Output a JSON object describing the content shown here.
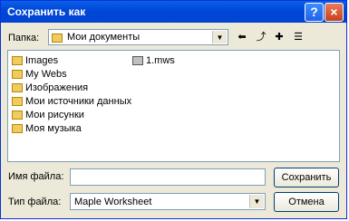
{
  "window": {
    "title": "Сохранить как"
  },
  "toolbar": {
    "folder_label": "Папка:",
    "folder_value": "Мои документы"
  },
  "files": [
    {
      "name": "Images",
      "icon": "folder-icon"
    },
    {
      "name": "My Webs",
      "icon": "folder-icon"
    },
    {
      "name": "Изображения",
      "icon": "folder-icon"
    },
    {
      "name": "Мои источники данных",
      "icon": "folder-data-icon"
    },
    {
      "name": "Мои рисунки",
      "icon": "folder-pictures-icon"
    },
    {
      "name": "Моя музыка",
      "icon": "folder-music-icon"
    },
    {
      "name": "1.mws",
      "icon": "file-mws-icon"
    }
  ],
  "footer": {
    "filename_label": "Имя файла:",
    "filename_value": "",
    "filetype_label": "Тип файла:",
    "filetype_value": "Maple Worksheet",
    "save_label": "Сохранить",
    "cancel_label": "Отмена"
  },
  "colors": {
    "titlebar": "#0054e3",
    "dialog_bg": "#ece9d8"
  }
}
